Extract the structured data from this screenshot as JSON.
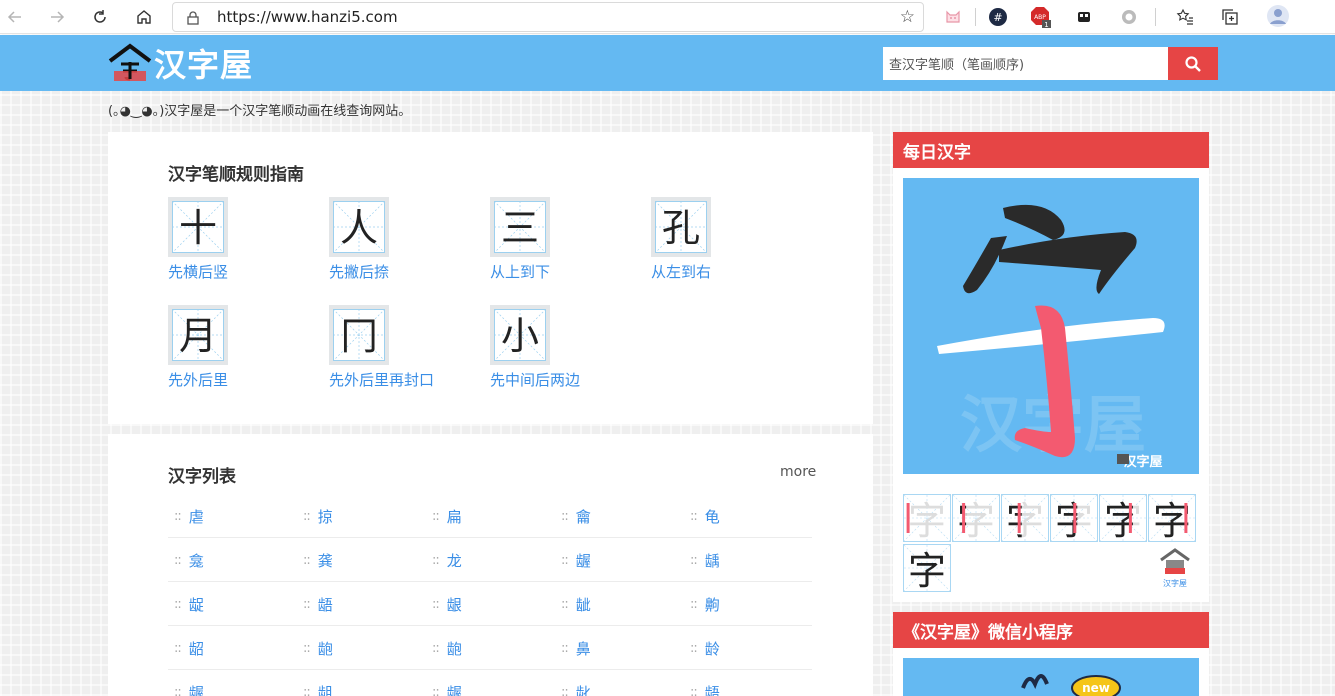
{
  "browser": {
    "url": "https://www.hanzi5.com",
    "ext_badge_count": "1"
  },
  "header": {
    "logo_text": "汉字屋",
    "search_placeholder": "查汉字笔顺（笔画顺序)"
  },
  "tagline": "(｡◕‿◕｡)汉字屋是一个汉字笔顺动画在线查询网站。",
  "guide": {
    "title": "汉字笔顺规则指南",
    "items": [
      {
        "label": "先横后竖",
        "glyph": "十"
      },
      {
        "label": "先撇后捺",
        "glyph": "人"
      },
      {
        "label": "从上到下",
        "glyph": "三"
      },
      {
        "label": "从左到右",
        "glyph": "孔"
      },
      {
        "label": "先外后里",
        "glyph": "月"
      },
      {
        "label": "先外后里再封口",
        "glyph": "冂"
      },
      {
        "label": "先中间后两边",
        "glyph": "小"
      }
    ]
  },
  "char_list": {
    "title": "汉字列表",
    "more": "more",
    "rows": [
      [
        "虐",
        "掠",
        "扁",
        "龠",
        "龟"
      ],
      [
        "龛",
        "龚",
        "龙",
        "龌",
        "龋"
      ],
      [
        "龊",
        "龉",
        "龈",
        "龇",
        "齁"
      ],
      [
        "龆",
        "龅",
        "龅",
        "鼻",
        "龄"
      ],
      [
        "龌",
        "龃",
        "龌",
        "龀",
        "龉"
      ]
    ]
  },
  "daily": {
    "title": "每日汉字",
    "character": "字",
    "watermark": "汉字屋",
    "brand_small": "汉字屋",
    "step_chars": [
      "字",
      "字",
      "字",
      "字",
      "字",
      "字",
      "字"
    ],
    "accent_color": "#e64545",
    "highlight_color": "#f35a70"
  },
  "wechat": {
    "title": "《汉字屋》微信小程序",
    "badge": "new"
  }
}
